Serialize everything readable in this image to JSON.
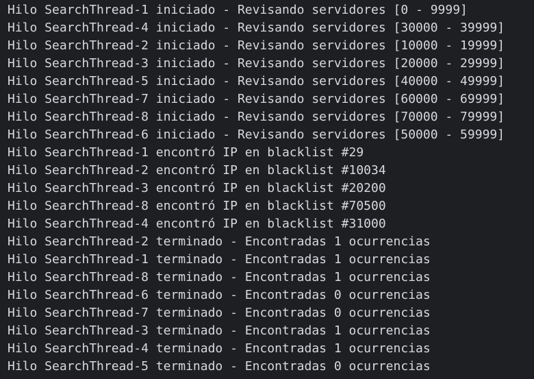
{
  "console": {
    "lines": [
      "Hilo SearchThread-1 iniciado - Revisando servidores [0 - 9999]",
      "Hilo SearchThread-4 iniciado - Revisando servidores [30000 - 39999]",
      "Hilo SearchThread-2 iniciado - Revisando servidores [10000 - 19999]",
      "Hilo SearchThread-3 iniciado - Revisando servidores [20000 - 29999]",
      "Hilo SearchThread-5 iniciado - Revisando servidores [40000 - 49999]",
      "Hilo SearchThread-7 iniciado - Revisando servidores [60000 - 69999]",
      "Hilo SearchThread-8 iniciado - Revisando servidores [70000 - 79999]",
      "Hilo SearchThread-6 iniciado - Revisando servidores [50000 - 59999]",
      "Hilo SearchThread-1 encontró IP en blacklist #29",
      "Hilo SearchThread-2 encontró IP en blacklist #10034",
      "Hilo SearchThread-3 encontró IP en blacklist #20200",
      "Hilo SearchThread-8 encontró IP en blacklist #70500",
      "Hilo SearchThread-4 encontró IP en blacklist #31000",
      "Hilo SearchThread-2 terminado - Encontradas 1 ocurrencias",
      "Hilo SearchThread-1 terminado - Encontradas 1 ocurrencias",
      "Hilo SearchThread-8 terminado - Encontradas 1 ocurrencias",
      "Hilo SearchThread-6 terminado - Encontradas 0 ocurrencias",
      "Hilo SearchThread-7 terminado - Encontradas 0 ocurrencias",
      "Hilo SearchThread-3 terminado - Encontradas 1 ocurrencias",
      "Hilo SearchThread-4 terminado - Encontradas 1 ocurrencias",
      "Hilo SearchThread-5 terminado - Encontradas 0 ocurrencias"
    ]
  },
  "colors": {
    "background": "#1e1f22",
    "text": "#d6d9de"
  }
}
